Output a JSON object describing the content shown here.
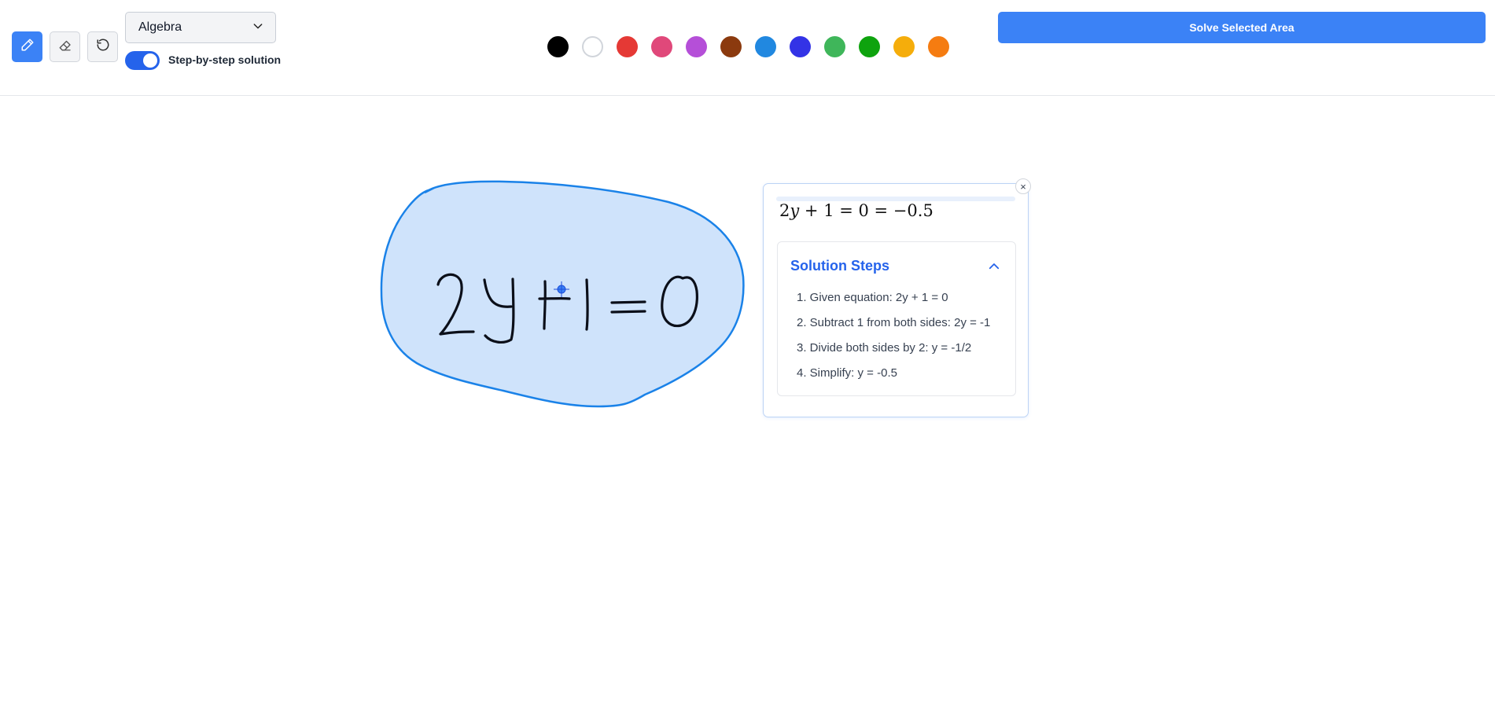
{
  "toolbar": {
    "tools": [
      {
        "name": "pen",
        "icon": "pencil-icon",
        "active": true
      },
      {
        "name": "eraser",
        "icon": "eraser-icon",
        "active": false
      },
      {
        "name": "undo",
        "icon": "undo-icon",
        "active": false
      }
    ],
    "subject_select": {
      "value": "Algebra",
      "icon": "chevron-down-icon"
    },
    "step_toggle": {
      "on": true,
      "label": "Step-by-step solution"
    },
    "colors": [
      "#000000",
      "#ffffff",
      "#e53935",
      "#e0487a",
      "#b54fd8",
      "#8b3a0e",
      "#2188e0",
      "#3333e6",
      "#3fb65a",
      "#0ea30e",
      "#f5ad0b",
      "#f57c11"
    ],
    "solve_label": "Solve Selected Area"
  },
  "canvas": {
    "handwritten_expression": "2y+1=0",
    "selection_fill": "#cfe3fb",
    "selection_stroke": "#1a82e8"
  },
  "result_panel": {
    "close_symbol": "×",
    "result_parts": [
      "2",
      "y",
      " + 1 = 0 = −0.5"
    ],
    "steps_title": "Solution Steps",
    "steps": [
      "1. Given equation: 2y + 1 = 0",
      "2. Subtract 1 from both sides: 2y = -1",
      "3. Divide both sides by 2: y = -1/2",
      "4. Simplify: y = -0.5"
    ]
  }
}
